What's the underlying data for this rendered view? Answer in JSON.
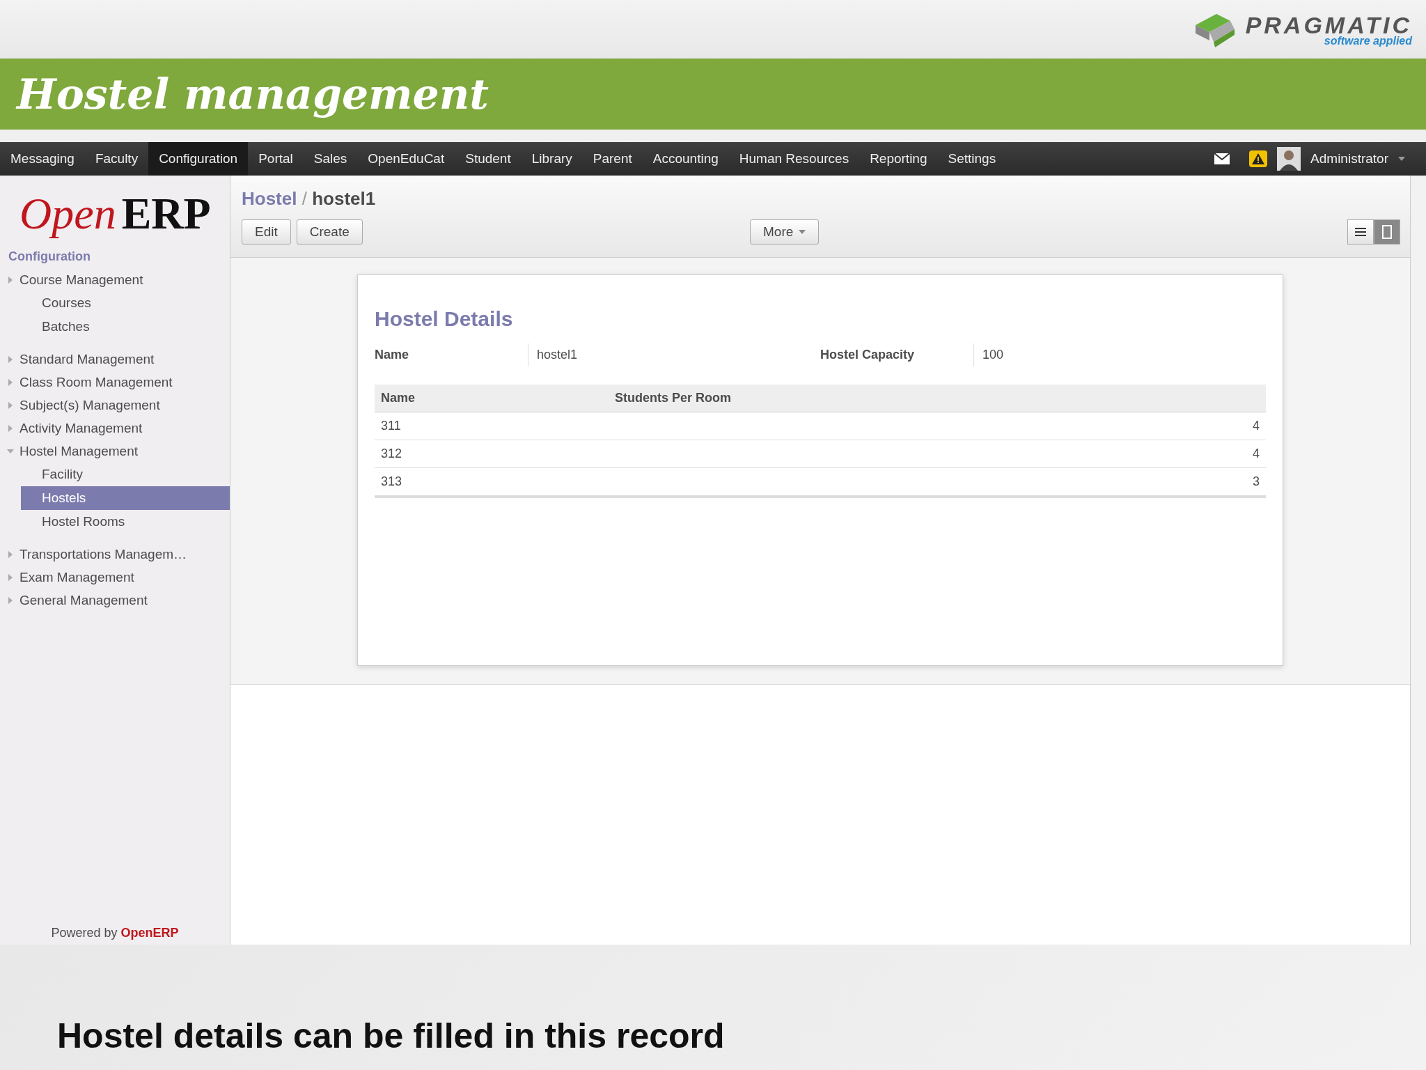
{
  "brand": {
    "name": "PRAGMATIC",
    "tagline": "software applied"
  },
  "slide_title": "Hostel management",
  "menu": [
    {
      "label": "Messaging",
      "selected": false
    },
    {
      "label": "Faculty",
      "selected": false
    },
    {
      "label": "Configuration",
      "selected": true
    },
    {
      "label": "Portal",
      "selected": false
    },
    {
      "label": "Sales",
      "selected": false
    },
    {
      "label": "OpenEduCat",
      "selected": false
    },
    {
      "label": "Student",
      "selected": false
    },
    {
      "label": "Library",
      "selected": false
    },
    {
      "label": "Parent",
      "selected": false
    },
    {
      "label": "Accounting",
      "selected": false
    },
    {
      "label": "Human Resources",
      "selected": false
    },
    {
      "label": "Reporting",
      "selected": false
    },
    {
      "label": "Settings",
      "selected": false
    }
  ],
  "user": {
    "name": "Administrator"
  },
  "logo": {
    "part_1": "Open",
    "part_2": "ERP"
  },
  "sidebar": {
    "heading": "Configuration",
    "items": [
      {
        "label": "Course Management",
        "expanded": false,
        "children": [
          {
            "label": "Courses",
            "selected": false
          },
          {
            "label": "Batches",
            "selected": false
          }
        ]
      },
      {
        "label": "Standard Management",
        "expanded": false
      },
      {
        "label": "Class Room Management",
        "expanded": false
      },
      {
        "label": "Subject(s) Management",
        "expanded": false
      },
      {
        "label": "Activity Management",
        "expanded": false
      },
      {
        "label": "Hostel Management",
        "expanded": true,
        "children": [
          {
            "label": "Facility",
            "selected": false
          },
          {
            "label": "Hostels",
            "selected": true
          },
          {
            "label": "Hostel Rooms",
            "selected": false
          }
        ]
      },
      {
        "label": "Transportations Managem…",
        "expanded": false
      },
      {
        "label": "Exam Management",
        "expanded": false
      },
      {
        "label": "General Management",
        "expanded": false
      }
    ],
    "footer": {
      "prefix": "Powered by",
      "brand": "OpenERP"
    }
  },
  "breadcrumb": {
    "parent": "Hostel",
    "separator": "/",
    "current": "hostel1"
  },
  "buttons": [
    "Edit",
    "Create"
  ],
  "more_button": "More",
  "form": {
    "title": "Hostel Details",
    "fields": [
      {
        "label": "Name",
        "value": "hostel1"
      },
      {
        "label": "Hostel Capacity",
        "value": "100"
      }
    ],
    "table": {
      "columns": [
        "Name",
        "Students Per Room"
      ],
      "rows": [
        [
          "311",
          "4"
        ],
        [
          "312",
          "4"
        ],
        [
          "313",
          "3"
        ]
      ]
    }
  },
  "caption": "Hostel details can be filled in this record"
}
